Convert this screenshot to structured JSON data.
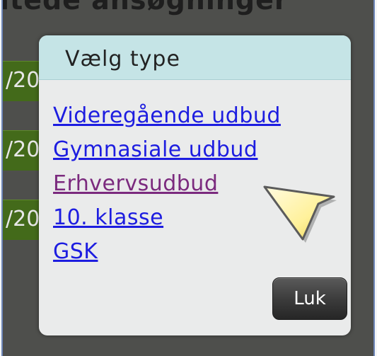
{
  "page": {
    "heading": "ltede ansøgninger",
    "row_labels": [
      "/20",
      "/20",
      "/20"
    ]
  },
  "dialog": {
    "title": "Vælg type",
    "options": [
      {
        "label": "Videregående udbud",
        "visited": false
      },
      {
        "label": "Gymnasiale udbud",
        "visited": false
      },
      {
        "label": "Erhvervsudbud",
        "visited": true
      },
      {
        "label": "10. klasse",
        "visited": false
      },
      {
        "label": "GSK",
        "visited": false
      }
    ],
    "close_label": "Luk"
  },
  "colors": {
    "link": "#1d1de0",
    "visited_link": "#7b2a7e",
    "header_bg": "#c5e4e6",
    "row_tab": "#436a1a"
  },
  "cursor_icon": "pointer-arrow-icon"
}
